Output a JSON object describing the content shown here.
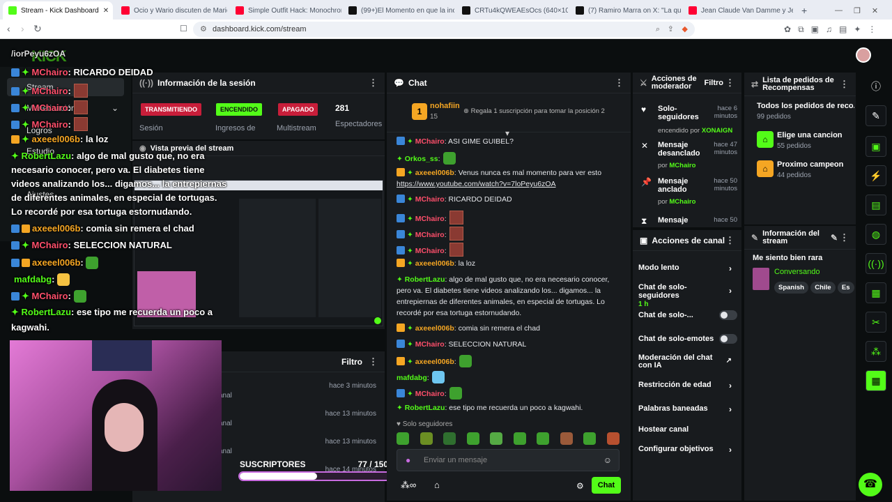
{
  "browser": {
    "tabs": [
      {
        "title": "Stream - Kick Dashboard",
        "color": "#53fc18"
      },
      {
        "title": "Ocio y Wario discuten de Mario Sun",
        "color": "#ff0033"
      },
      {
        "title": "Simple Outfit Hack: Monochrome St",
        "color": "#ff0033"
      },
      {
        "title": "(99+)El Momento en que la inclinaci",
        "color": "#111111"
      },
      {
        "title": "CRTu4kQWEAEsOcs (640×1024)",
        "color": "#111111"
      },
      {
        "title": "(7) Ramiro Marra on X: \"La que aniq",
        "color": "#111111"
      },
      {
        "title": "Jean Claude Van Damme y Jennifer",
        "color": "#ff0033"
      }
    ],
    "url": "dashboard.kick.com/stream"
  },
  "overlay_chat": [
    {
      "user": "/iorPeyu6zOA",
      "text": ""
    },
    {
      "user": "MChairo",
      "text": ": RICARDO DEIDAD"
    },
    {
      "user": "MChairo",
      "text": ":"
    },
    {
      "user": "MChairo",
      "text": ":"
    },
    {
      "user": "MChairo",
      "text": ":"
    },
    {
      "user": "axeeel006b",
      "text": ": la loz"
    },
    {
      "user": "RobertLazu",
      "text": ": algo de mal gusto que, no era"
    },
    {
      "user": "",
      "text": "necesario conocer, pero va. El diabetes tiene"
    },
    {
      "user": "",
      "text": "videos analizando los... digamos... la entrepiernas"
    },
    {
      "user": "",
      "text": "de diferentes animales, en especial de tortugas."
    },
    {
      "user": "",
      "text": "Lo recordé por esa tortuga estornudando."
    },
    {
      "user": "axeeel006b",
      "text": ": comia sin remera el chad"
    },
    {
      "user": "MChairo",
      "text": ": SELECCION NATURAL"
    },
    {
      "user": "axeeel006b",
      "text": ":"
    },
    {
      "user": "mafdabg",
      "text": ":"
    },
    {
      "user": "MChairo",
      "text": ":"
    },
    {
      "user": "RobertLazu",
      "text": ": ese tipo me recuerda un poco a"
    },
    {
      "user": "",
      "text": "kagwahi."
    }
  ],
  "sidebar_ghost": [
    "Stream",
    "Monetización",
    "Logros",
    "Estudio",
    "Ajustes"
  ],
  "session": {
    "title": "Información de la sesión",
    "status_transmitiendo": "TRANSMITIENDO",
    "status_encendido": "ENCENDIDO",
    "status_apagado": "APAGADO",
    "viewers": "281",
    "label_sesion": "Sesión",
    "label_ingresos": "Ingresos de",
    "label_multistream": "Multistream",
    "label_espectadores": "Espectadores"
  },
  "preview": {
    "title": "Vista previa del stream"
  },
  "activity": {
    "filter": "Filtro",
    "times": [
      "hace 3 minutos",
      "hace 13 minutos",
      "hace 13 minutos",
      "hace 14 minutos"
    ],
    "canal": "anal"
  },
  "subs": {
    "label": "SUSCRIPTORES",
    "count": "77 / 150",
    "progress": 0.513
  },
  "chat": {
    "title": "Chat",
    "gifter": "nohafiin",
    "gifter_count": "15",
    "gift_cta": "Regala 1 suscripción para tomar la posición 2",
    "messages": [
      {
        "user": "MChairo",
        "color": "#ff4f6b",
        "text": ": ASI GIME GUIBEL?"
      },
      {
        "user": "Orkos_ss",
        "color": "#53fc18",
        "text": ":"
      },
      {
        "user": "axeeel006b",
        "color": "#f5a623",
        "text": ": Venus nunca es mal momento para ver esto"
      },
      {
        "user": "",
        "color": "",
        "text": "https://www.youtube.com/watch?v=7loPeyu6zOA"
      },
      {
        "user": "MChairo",
        "color": "#ff4f6b",
        "text": ": RICARDO DEIDAD"
      },
      {
        "user": "MChairo",
        "color": "#ff4f6b",
        "text": ":"
      },
      {
        "user": "MChairo",
        "color": "#ff4f6b",
        "text": ":"
      },
      {
        "user": "MChairo",
        "color": "#ff4f6b",
        "text": ":"
      },
      {
        "user": "axeeel006b",
        "color": "#f5a623",
        "text": ": la loz"
      },
      {
        "user": "RobertLazu",
        "color": "#53fc18",
        "text": ": algo de mal gusto que, no era necesario conocer,"
      },
      {
        "user": "",
        "color": "",
        "text": "pero va. El diabetes tiene videos analizando los... digamos... la"
      },
      {
        "user": "",
        "color": "",
        "text": "entrepiernas de diferentes animales, en especial de tortugas. Lo"
      },
      {
        "user": "",
        "color": "",
        "text": "recordé por esa tortuga estornudando."
      },
      {
        "user": "axeeel006b",
        "color": "#f5a623",
        "text": ": comia sin remera el chad"
      },
      {
        "user": "MChairo",
        "color": "#ff4f6b",
        "text": ": SELECCION NATURAL"
      },
      {
        "user": "axeeel006b",
        "color": "#f5a623",
        "text": ":"
      },
      {
        "user": "mafdabg",
        "color": "#53fc18",
        "text": ":"
      },
      {
        "user": "MChairo",
        "color": "#ff4f6b",
        "text": ":"
      },
      {
        "user": "RobertLazu",
        "color": "#53fc18",
        "text": ": ese tipo me recuerda un poco a kagwahi."
      }
    ],
    "followers_only": "Solo seguidores",
    "placeholder": "Enviar un mensaje",
    "send": "Chat"
  },
  "mod_actions": {
    "title": "Acciones de moderador",
    "filter": "Filtro",
    "items": [
      {
        "title": "Solo-seguidores",
        "line2": "encendido por",
        "by": "XONAIGN",
        "time": "hace 6 minutos"
      },
      {
        "title": "Mensaje desanclado",
        "line2": "por",
        "by": "MChairo",
        "time": "hace 47 minutos"
      },
      {
        "title": "Mensaje anclado",
        "line2": "por",
        "by": "MChairo",
        "time": "hace 50 minutos"
      },
      {
        "title": "Mensaje",
        "line2": "",
        "by": "",
        "time": "hace 50"
      }
    ]
  },
  "channel_actions": {
    "title": "Acciones de canal",
    "modo_lento": "Modo lento",
    "solo_seg": "Chat de solo-seguidores",
    "solo_seg_sub": "1 h",
    "solo_sub": "Chat de solo-...",
    "solo_emotes": "Chat de solo-emotes",
    "ia": "Moderación del chat con IA",
    "edad": "Restricción de edad",
    "baneadas": "Palabras baneadas",
    "host": "Hostear canal",
    "objetivos": "Configurar objetivos"
  },
  "rewards": {
    "title": "Lista de pedidos de Recompensas",
    "all": "Todos los pedidos de reco...",
    "all_count": "99 pedidos",
    "items": [
      {
        "title": "Elige una cancion",
        "count": "55 pedidos",
        "color": "#53fc18"
      },
      {
        "title": "Proximo campeon",
        "count": "44 pedidos",
        "color": "#f5a623"
      }
    ]
  },
  "stream_info": {
    "title": "Información del stream",
    "stream_title": "Me siento bien rara",
    "category": "Conversando",
    "tags": [
      "Spanish",
      "Chile",
      "Es"
    ]
  }
}
